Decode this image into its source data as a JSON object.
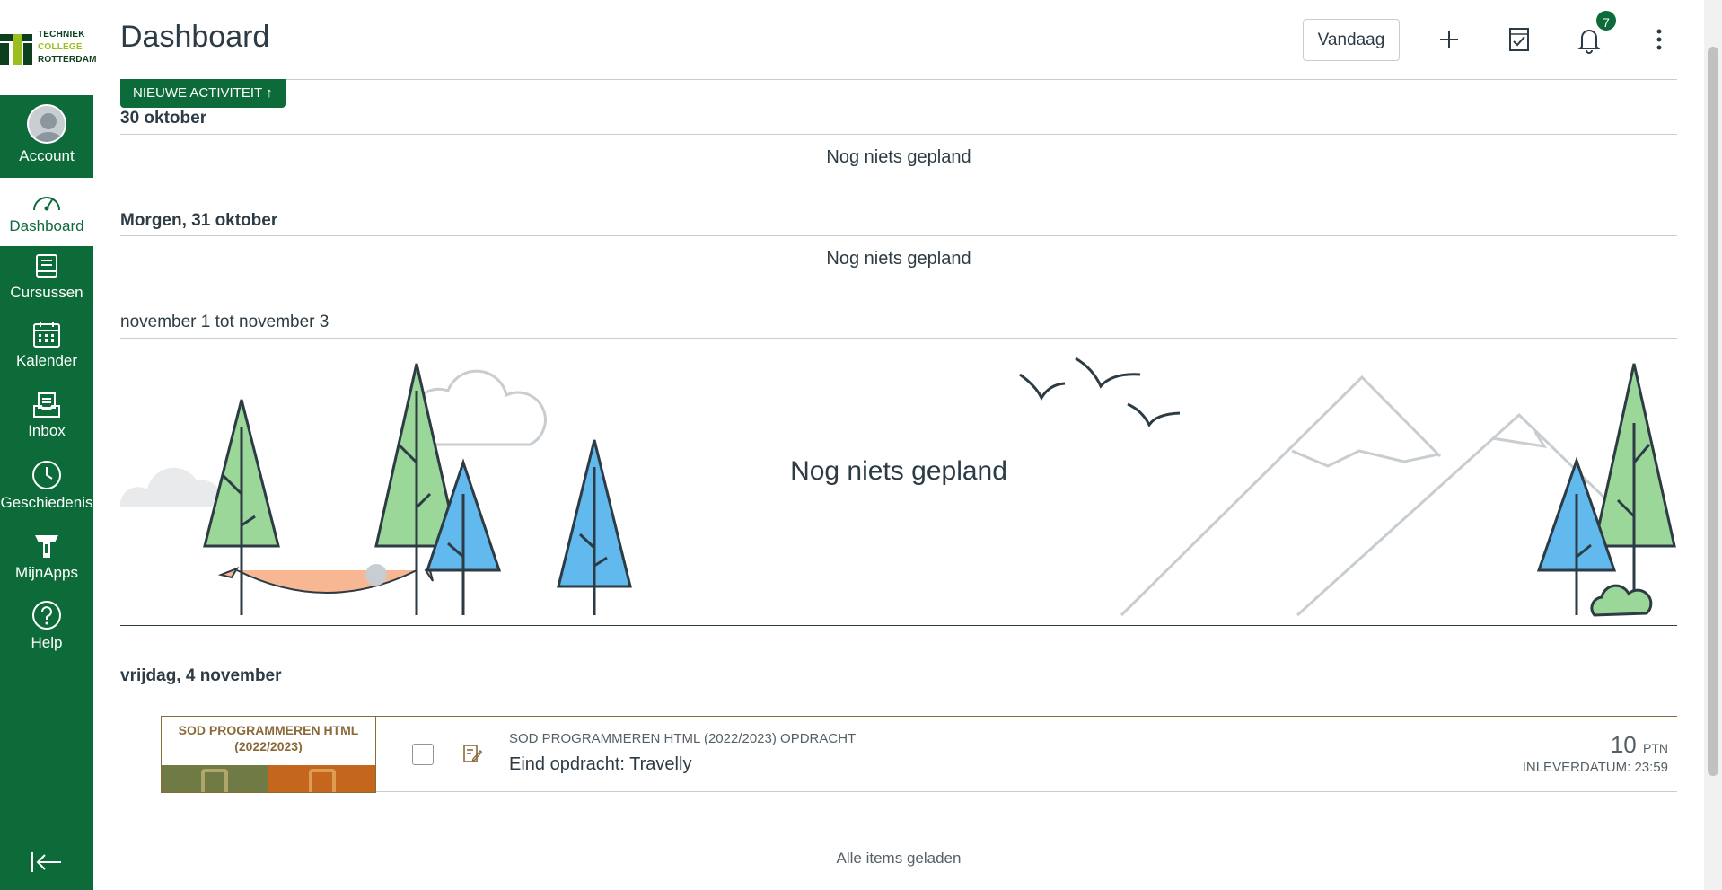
{
  "nav": {
    "logo": {
      "line1": "TECHNIEK",
      "line2": "COLLEGE",
      "line3": "ROTTERDAM"
    },
    "items": [
      {
        "label": "Account",
        "icon": "avatar"
      },
      {
        "label": "Dashboard",
        "icon": "dashboard-icon"
      },
      {
        "label": "Cursussen",
        "icon": "book-icon"
      },
      {
        "label": "Kalender",
        "icon": "calendar-icon"
      },
      {
        "label": "Inbox",
        "icon": "inbox-icon"
      },
      {
        "label": "Geschiedenis",
        "icon": "clock-icon"
      },
      {
        "label": "MijnApps",
        "icon": "apps-icon"
      },
      {
        "label": "Help",
        "icon": "help-icon"
      }
    ]
  },
  "header": {
    "title": "Dashboard",
    "today_label": "Vandaag",
    "notification_count": "7"
  },
  "new_activity_label": "NIEUWE ACTIVITEIT ↑",
  "days": [
    {
      "title": "30 oktober",
      "empty": "Nog niets gepland"
    },
    {
      "title": "Morgen, 31 oktober",
      "empty": "Nog niets gepland"
    },
    {
      "title": "november 1 tot november 3",
      "empty": "Nog niets gepland"
    },
    {
      "title": "vrijdag, 4 november"
    }
  ],
  "planner_item": {
    "course_tile": "SOD PROGRAMMEREN HTML (2022/2023)",
    "course_type": "SOD PROGRAMMEREN HTML (2022/2023) OPDRACHT",
    "title": "Eind opdracht: Travelly",
    "points": "10",
    "points_unit": "PTN",
    "due": "INLEVERDATUM: 23:59"
  },
  "footer_text": "Alle items geladen",
  "colors": {
    "brand": "#0d6b3a",
    "course": "#8b6a3a"
  }
}
